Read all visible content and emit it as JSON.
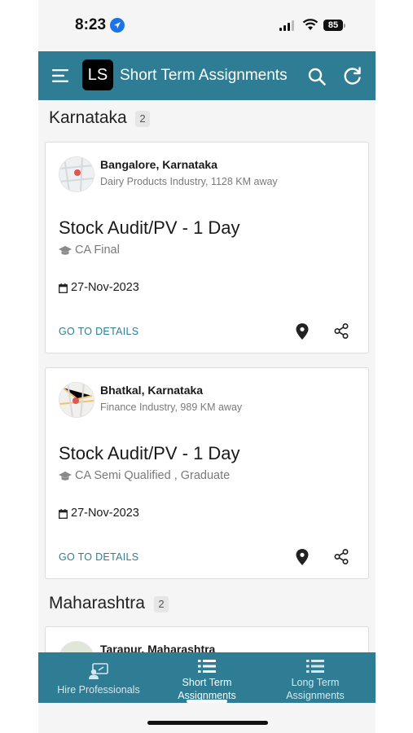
{
  "status_bar": {
    "time": "8:23",
    "battery": "85"
  },
  "header": {
    "logo_text": "LS",
    "title": "Short Term Assignments"
  },
  "groups": [
    {
      "name": "Karnataka",
      "count": "2",
      "cards": [
        {
          "location": "Bangalore, Karnataka",
          "subtitle": "Dairy Products Industry, 1128 KM away",
          "job_title": "Stock Audit/PV - 1 Day",
          "qualification": "CA Final",
          "date": "27-Nov-2023",
          "details_label": "GO TO DETAILS"
        },
        {
          "location": "Bhatkal, Karnataka",
          "subtitle": "Finance Industry, 989 KM away",
          "job_title": "Stock Audit/PV - 1 Day",
          "qualification": "CA Semi Qualified , Graduate",
          "date": "27-Nov-2023",
          "details_label": "GO TO DETAILS"
        }
      ]
    },
    {
      "name": "Maharashtra",
      "count": "2",
      "cards": [
        {
          "location": "Tarapur, Maharashtra"
        }
      ]
    }
  ],
  "bottom_nav": [
    {
      "line1": "Hire Professionals",
      "icon": "hire-icon",
      "active": false
    },
    {
      "line1": "Short Term",
      "line2": "Assignments",
      "icon": "list-icon",
      "active": true
    },
    {
      "line1": "Long Term",
      "line2": "Assignments",
      "icon": "list-icon",
      "active": false
    }
  ],
  "colors": {
    "primary": "#2e7d94",
    "background": "#f5f5f5"
  }
}
